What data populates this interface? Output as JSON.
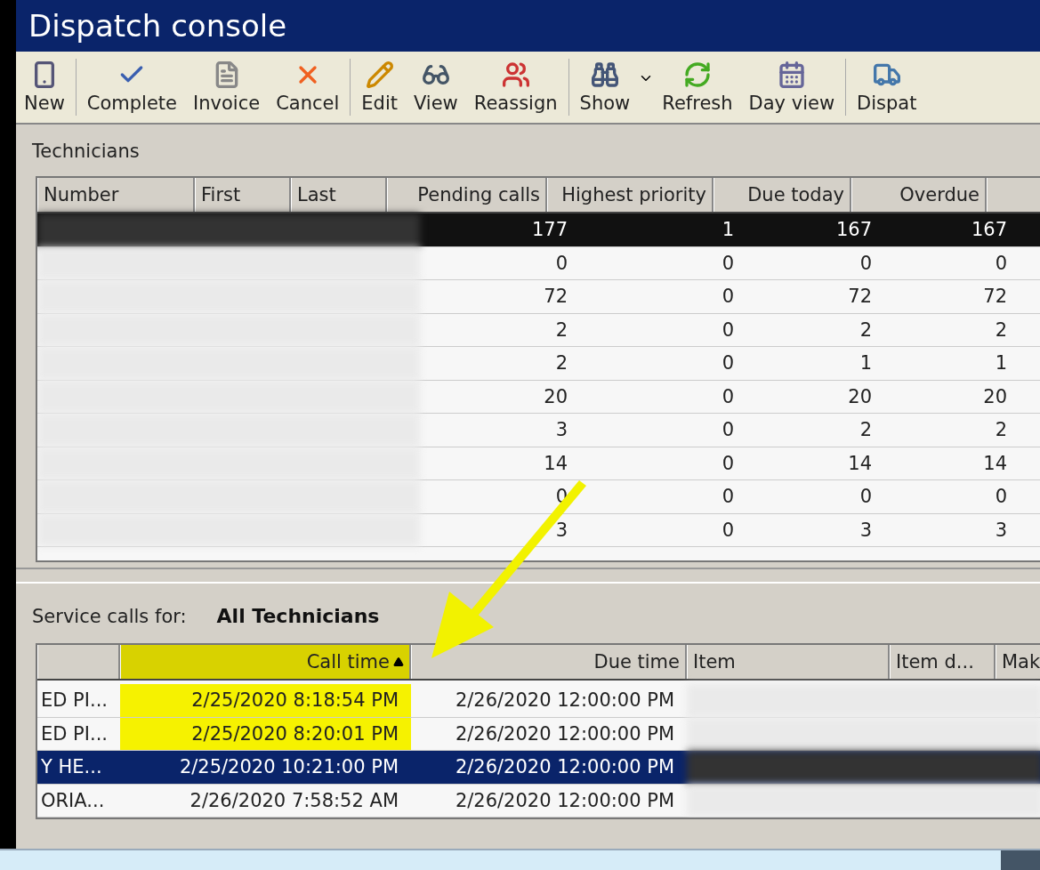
{
  "window": {
    "title": "Dispatch console"
  },
  "toolbar": [
    {
      "label": "New",
      "kind": "new"
    },
    {
      "label": "Complete",
      "kind": "complete"
    },
    {
      "label": "Invoice",
      "kind": "invoice"
    },
    {
      "label": "Cancel",
      "kind": "cancel"
    },
    {
      "label": "Edit",
      "kind": "edit"
    },
    {
      "label": "View",
      "kind": "view"
    },
    {
      "label": "Reassign",
      "kind": "reassign"
    },
    {
      "label": "Show",
      "kind": "show"
    },
    {
      "label": "Refresh",
      "kind": "refresh"
    },
    {
      "label": "Day view",
      "kind": "day"
    },
    {
      "label": "Dispat",
      "kind": "dispatch"
    }
  ],
  "technicians": {
    "title": "Technicians",
    "columns": [
      "Number",
      "First",
      "Last",
      "Pending calls",
      "Highest priority",
      "Due today",
      "Overdue"
    ],
    "rows": [
      {
        "selected": true,
        "values": [
          "177",
          "1",
          "167",
          "167"
        ]
      },
      {
        "selected": false,
        "values": [
          "0",
          "0",
          "0",
          "0"
        ]
      },
      {
        "selected": false,
        "values": [
          "72",
          "0",
          "72",
          "72"
        ]
      },
      {
        "selected": false,
        "values": [
          "2",
          "0",
          "2",
          "2"
        ]
      },
      {
        "selected": false,
        "values": [
          "2",
          "0",
          "1",
          "1"
        ]
      },
      {
        "selected": false,
        "values": [
          "20",
          "0",
          "20",
          "20"
        ]
      },
      {
        "selected": false,
        "values": [
          "3",
          "0",
          "2",
          "2"
        ]
      },
      {
        "selected": false,
        "values": [
          "14",
          "0",
          "14",
          "14"
        ]
      },
      {
        "selected": false,
        "values": [
          "0",
          "0",
          "0",
          "0"
        ]
      },
      {
        "selected": false,
        "values": [
          "3",
          "0",
          "3",
          "3"
        ]
      }
    ]
  },
  "service_calls": {
    "label": "Service calls for:",
    "value": "All Technicians",
    "columns": [
      {
        "highlighted": false
      },
      {
        "label": "Call time",
        "highlighted": true,
        "sorted": true
      },
      {
        "label": "Due time",
        "highlighted": false
      },
      {
        "label": "Item",
        "highlighted": false
      },
      {
        "label": "Item d...",
        "highlighted": false
      },
      {
        "label": "Mak",
        "highlighted": false
      }
    ],
    "rows": [
      {
        "selected": false,
        "highlighted": true,
        "column_1": "ED PI...",
        "call_time": "2/25/2020 8:18:54 PM",
        "due_time": "2/26/2020 12:00:00 PM"
      },
      {
        "selected": false,
        "highlighted": true,
        "column_1": "ED PI...",
        "call_time": "2/25/2020 8:20:01 PM",
        "due_time": "2/26/2020 12:00:00 PM"
      },
      {
        "selected": true,
        "highlighted": false,
        "column_1": "Y HE...",
        "call_time": "2/25/2020 10:21:00 PM",
        "due_time": "2/26/2020 12:00:00 PM"
      },
      {
        "selected": false,
        "highlighted": false,
        "column_1": "ORIA...",
        "call_time": "2/26/2020 7:58:52 AM",
        "due_time": "2/26/2020 12:00:00 PM"
      }
    ]
  }
}
